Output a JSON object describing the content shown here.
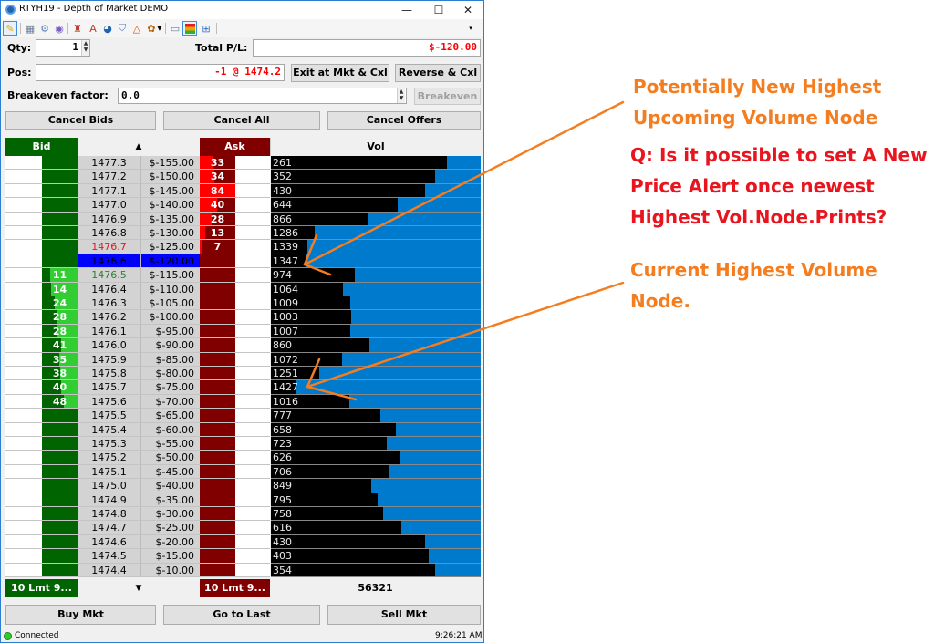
{
  "window": {
    "title": "RTYH19 - Depth of Market DEMO",
    "controls": {
      "minimize": "—",
      "maximize": "☐",
      "close": "✕"
    }
  },
  "toolbar": {
    "icons": [
      "pencil-brush-icon",
      "calculator-icon",
      "gear-icon",
      "eye-icon",
      "chart-wizard-icon",
      "alert-icon",
      "clock-icon",
      "shield-icon",
      "triangle-icon",
      "paint-icon",
      "dropdown-arrow-icon",
      "picture-icon",
      "heatmap-icon",
      "columns-icon"
    ]
  },
  "controls": {
    "qty_label": "Qty:",
    "qty_value": "1",
    "total_pl_label": "Total P/L:",
    "total_pl_value": "$-120.00",
    "pos_label": "Pos:",
    "pos_value": "-1 @ 1474.2",
    "exit_button": "Exit at Mkt & Cxl",
    "reverse_button": "Reverse & Cxl",
    "breakeven_label": "Breakeven factor:",
    "breakeven_value": "0.0",
    "breakeven_button": "Breakeven",
    "cancel_bids": "Cancel Bids",
    "cancel_all": "Cancel All",
    "cancel_offers": "Cancel Offers"
  },
  "colors": {
    "bid": "#006400",
    "bid_fill": "#32cd32",
    "ask": "#800000",
    "ask_fill": "#ff0000",
    "vol_bar": "#007acc",
    "current_price": "#0000ff",
    "annotation_orange": "#f47d20",
    "annotation_red": "#e8141e"
  },
  "dom": {
    "headers": {
      "bid": "Bid",
      "price": "▲",
      "ask": "Ask",
      "vol": "Vol"
    },
    "max_size": 84,
    "max_vol": 1427,
    "current_row": 7,
    "rows": [
      {
        "price": "1477.3",
        "pnl": "$-155.00",
        "bid": "",
        "ask": "33",
        "vol": "261"
      },
      {
        "price": "1477.2",
        "pnl": "$-150.00",
        "bid": "",
        "ask": "34",
        "vol": "352"
      },
      {
        "price": "1477.1",
        "pnl": "$-145.00",
        "bid": "",
        "ask": "84",
        "vol": "430"
      },
      {
        "price": "1477.0",
        "pnl": "$-140.00",
        "bid": "",
        "ask": "40",
        "vol": "644"
      },
      {
        "price": "1476.9",
        "pnl": "$-135.00",
        "bid": "",
        "ask": "28",
        "vol": "866"
      },
      {
        "price": "1476.8",
        "pnl": "$-130.00",
        "bid": "",
        "ask": "13",
        "vol": "1286"
      },
      {
        "price": "1476.7",
        "pnl": "$-125.00",
        "bid": "",
        "ask": "7",
        "vol": "1339",
        "price_color": "#e8141e"
      },
      {
        "price": "1476.6",
        "pnl": "$-120.00",
        "bid": "",
        "ask": "",
        "vol": "1347"
      },
      {
        "price": "1476.5",
        "pnl": "$-115.00",
        "bid": "11",
        "ask": "",
        "vol": "974",
        "price_color": "#2e7d32"
      },
      {
        "price": "1476.4",
        "pnl": "$-110.00",
        "bid": "14",
        "ask": "",
        "vol": "1064"
      },
      {
        "price": "1476.3",
        "pnl": "$-105.00",
        "bid": "24",
        "ask": "",
        "vol": "1009"
      },
      {
        "price": "1476.2",
        "pnl": "$-100.00",
        "bid": "28",
        "ask": "",
        "vol": "1003"
      },
      {
        "price": "1476.1",
        "pnl": "$-95.00",
        "bid": "28",
        "ask": "",
        "vol": "1007"
      },
      {
        "price": "1476.0",
        "pnl": "$-90.00",
        "bid": "41",
        "ask": "",
        "vol": "860"
      },
      {
        "price": "1475.9",
        "pnl": "$-85.00",
        "bid": "35",
        "ask": "",
        "vol": "1072"
      },
      {
        "price": "1475.8",
        "pnl": "$-80.00",
        "bid": "38",
        "ask": "",
        "vol": "1251"
      },
      {
        "price": "1475.7",
        "pnl": "$-75.00",
        "bid": "40",
        "ask": "",
        "vol": "1427"
      },
      {
        "price": "1475.6",
        "pnl": "$-70.00",
        "bid": "48",
        "ask": "",
        "vol": "1016"
      },
      {
        "price": "1475.5",
        "pnl": "$-65.00",
        "bid": "",
        "ask": "",
        "vol": "777"
      },
      {
        "price": "1475.4",
        "pnl": "$-60.00",
        "bid": "",
        "ask": "",
        "vol": "658"
      },
      {
        "price": "1475.3",
        "pnl": "$-55.00",
        "bid": "",
        "ask": "",
        "vol": "723"
      },
      {
        "price": "1475.2",
        "pnl": "$-50.00",
        "bid": "",
        "ask": "",
        "vol": "626"
      },
      {
        "price": "1475.1",
        "pnl": "$-45.00",
        "bid": "",
        "ask": "",
        "vol": "706"
      },
      {
        "price": "1475.0",
        "pnl": "$-40.00",
        "bid": "",
        "ask": "",
        "vol": "849"
      },
      {
        "price": "1474.9",
        "pnl": "$-35.00",
        "bid": "",
        "ask": "",
        "vol": "795"
      },
      {
        "price": "1474.8",
        "pnl": "$-30.00",
        "bid": "",
        "ask": "",
        "vol": "758"
      },
      {
        "price": "1474.7",
        "pnl": "$-25.00",
        "bid": "",
        "ask": "",
        "vol": "616"
      },
      {
        "price": "1474.6",
        "pnl": "$-20.00",
        "bid": "",
        "ask": "",
        "vol": "430"
      },
      {
        "price": "1474.5",
        "pnl": "$-15.00",
        "bid": "",
        "ask": "",
        "vol": "403"
      },
      {
        "price": "1474.4",
        "pnl": "$-10.00",
        "bid": "",
        "ask": "",
        "vol": "354"
      }
    ],
    "footer": {
      "bid_order": "10 Lmt 9...",
      "scroll_down": "▼",
      "ask_order": "10 Lmt 9...",
      "total_vol": "56321"
    }
  },
  "bottom_buttons": {
    "buy": "Buy Mkt",
    "go_last": "Go to Last",
    "sell": "Sell Mkt"
  },
  "status": {
    "connection": "Connected",
    "time": "9:26:21 AM"
  },
  "annotations": {
    "upcoming_node": [
      "Potentially New Highest",
      "Upcoming Volume Node"
    ],
    "question": [
      "Q: Is it possible to set A New",
      "Price Alert once newest",
      "Highest Vol.Node.Prints?"
    ],
    "current_node": [
      "Current Highest Volume",
      "Node."
    ]
  }
}
